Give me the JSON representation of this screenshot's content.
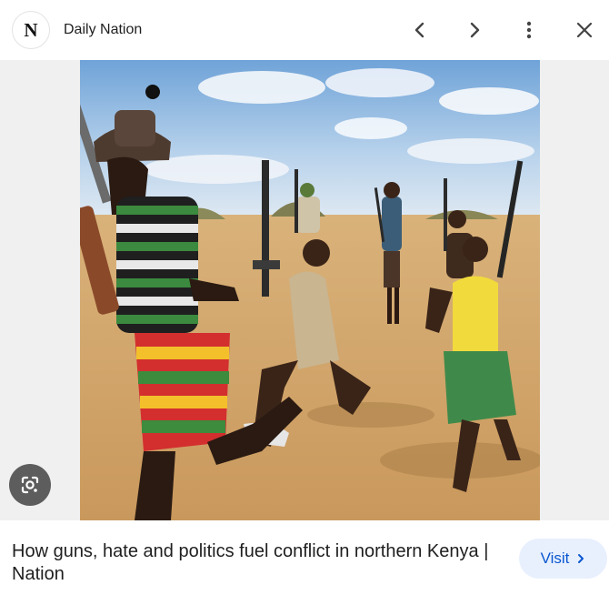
{
  "header": {
    "logo_letter": "N",
    "source_name": "Daily Nation",
    "icons": [
      "chevron-left-icon",
      "chevron-right-icon",
      "more-vert-icon",
      "close-icon"
    ]
  },
  "image": {
    "alt": "How guns, hate and politics fuel conflict in northern Kenya | Nation",
    "lens_icon": "google-lens-icon"
  },
  "caption": {
    "title": "How guns, hate and politics fuel conflict in northern Kenya | Nation"
  },
  "visit": {
    "label": "Visit",
    "accent": "#0b57d0",
    "background": "#e8f0fe"
  }
}
